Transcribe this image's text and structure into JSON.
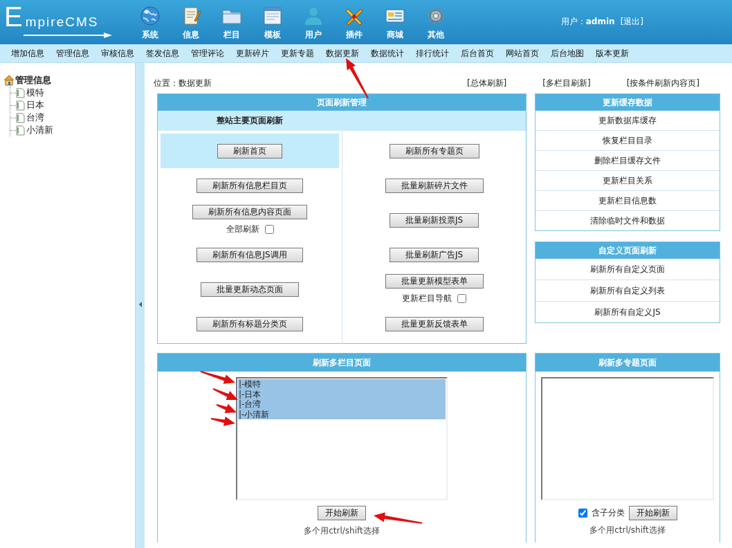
{
  "header": {
    "logo": "EmpireCMS",
    "nav": [
      {
        "label": "系统"
      },
      {
        "label": "信息"
      },
      {
        "label": "栏目"
      },
      {
        "label": "模板"
      },
      {
        "label": "用户"
      },
      {
        "label": "插件"
      },
      {
        "label": "商城"
      },
      {
        "label": "其他"
      }
    ],
    "user": "用户：**admin**",
    "logout": "[退出]"
  },
  "menu": [
    "增加信息",
    "管理信息",
    "审核信息",
    "签发信息",
    "管理评论",
    "更新碎片",
    "更新专题",
    "数据更新",
    "数据统计",
    "排行统计",
    "后台首页",
    "网站首页",
    "后台地图",
    "版本更新"
  ],
  "sidebar": {
    "root": "管理信息",
    "children": [
      {
        "label": "模特"
      },
      {
        "label": "日本"
      },
      {
        "label": "台湾"
      },
      {
        "label": "小清新"
      }
    ]
  },
  "location": "位置：数据更新",
  "top_links": [
    "[总体刷新]",
    "[多栏目刷新]",
    "[按条件刷新内容页]"
  ],
  "page_refresh": {
    "title": "页面刷新管理",
    "subtitle": "整站主要页面刷新",
    "left": [
      {
        "kind": "button",
        "label": "刷新首页",
        "highlighted": true
      },
      {
        "kind": "button",
        "label": "刷新所有信息栏目页",
        "highlighted": false
      },
      {
        "kind": "button_with_checkbox",
        "label": "刷新所有信息内容页面",
        "option": "全部刷新",
        "checked": false,
        "highlighted": false
      },
      {
        "kind": "button",
        "label": "刷新所有信息JS调用",
        "highlighted": false
      },
      {
        "kind": "button",
        "label": "批量更新动态页面",
        "highlighted": false
      },
      {
        "kind": "button",
        "label": "刷新所有标题分类页",
        "highlighted": false
      }
    ],
    "right": [
      {
        "kind": "button",
        "label": "刷新所有专题页",
        "highlighted": false
      },
      {
        "kind": "button",
        "label": "批量刷新碎片文件",
        "highlighted": false
      },
      {
        "kind": "button",
        "label": "批量刷新投票JS",
        "highlighted": false
      },
      {
        "kind": "button",
        "label": "批量刷新广告JS",
        "highlighted": false
      },
      {
        "kind": "button_with_checkbox",
        "label": "批量更新模型表单",
        "option": "更新栏目导航",
        "checked": false,
        "highlighted": false
      },
      {
        "kind": "button",
        "label": "批量更新反馈表单",
        "highlighted": false
      }
    ]
  },
  "cache": {
    "title": "更新缓存数据",
    "items": [
      "更新数据库缓存",
      "恢复栏目目录",
      "删除栏目缓存文件",
      "更新栏目关系",
      "更新栏目信息数",
      "清除临时文件和数据"
    ]
  },
  "custom": {
    "title": "自定义页面刷新",
    "items": [
      "刷新所有自定义页面",
      "刷新所有自定义列表",
      "刷新所有自定义JS"
    ]
  },
  "multi_column": {
    "title": "刷新多栏目页面",
    "options": [
      {
        "label": "|-模特",
        "selected": true
      },
      {
        "label": "|-日本",
        "selected": true
      },
      {
        "label": "|-台湾",
        "selected": true
      },
      {
        "label": "|-小清新",
        "selected": true
      }
    ],
    "button": "开始刷新",
    "hint": "多个用ctrl/shift选择"
  },
  "multi_topic": {
    "title": "刷新多专题页面",
    "include_sub": {
      "label": "含子分类",
      "checked": true
    },
    "button": "开始刷新",
    "hint": "多个用ctrl/shift选择"
  }
}
